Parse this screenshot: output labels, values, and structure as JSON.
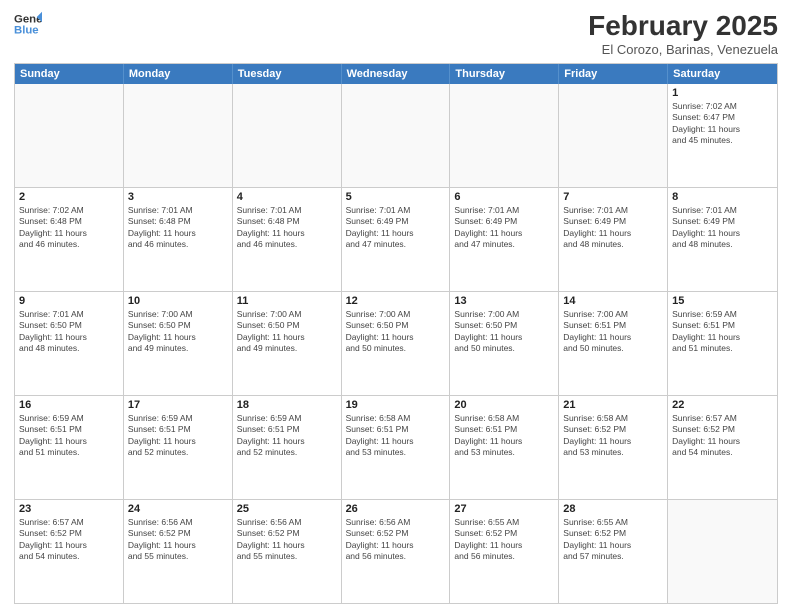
{
  "header": {
    "logo_general": "General",
    "logo_blue": "Blue",
    "month_year": "February 2025",
    "location": "El Corozo, Barinas, Venezuela"
  },
  "weekdays": [
    "Sunday",
    "Monday",
    "Tuesday",
    "Wednesday",
    "Thursday",
    "Friday",
    "Saturday"
  ],
  "rows": [
    [
      {
        "day": "",
        "info": ""
      },
      {
        "day": "",
        "info": ""
      },
      {
        "day": "",
        "info": ""
      },
      {
        "day": "",
        "info": ""
      },
      {
        "day": "",
        "info": ""
      },
      {
        "day": "",
        "info": ""
      },
      {
        "day": "1",
        "info": "Sunrise: 7:02 AM\nSunset: 6:47 PM\nDaylight: 11 hours\nand 45 minutes."
      }
    ],
    [
      {
        "day": "2",
        "info": "Sunrise: 7:02 AM\nSunset: 6:48 PM\nDaylight: 11 hours\nand 46 minutes."
      },
      {
        "day": "3",
        "info": "Sunrise: 7:01 AM\nSunset: 6:48 PM\nDaylight: 11 hours\nand 46 minutes."
      },
      {
        "day": "4",
        "info": "Sunrise: 7:01 AM\nSunset: 6:48 PM\nDaylight: 11 hours\nand 46 minutes."
      },
      {
        "day": "5",
        "info": "Sunrise: 7:01 AM\nSunset: 6:49 PM\nDaylight: 11 hours\nand 47 minutes."
      },
      {
        "day": "6",
        "info": "Sunrise: 7:01 AM\nSunset: 6:49 PM\nDaylight: 11 hours\nand 47 minutes."
      },
      {
        "day": "7",
        "info": "Sunrise: 7:01 AM\nSunset: 6:49 PM\nDaylight: 11 hours\nand 48 minutes."
      },
      {
        "day": "8",
        "info": "Sunrise: 7:01 AM\nSunset: 6:49 PM\nDaylight: 11 hours\nand 48 minutes."
      }
    ],
    [
      {
        "day": "9",
        "info": "Sunrise: 7:01 AM\nSunset: 6:50 PM\nDaylight: 11 hours\nand 48 minutes."
      },
      {
        "day": "10",
        "info": "Sunrise: 7:00 AM\nSunset: 6:50 PM\nDaylight: 11 hours\nand 49 minutes."
      },
      {
        "day": "11",
        "info": "Sunrise: 7:00 AM\nSunset: 6:50 PM\nDaylight: 11 hours\nand 49 minutes."
      },
      {
        "day": "12",
        "info": "Sunrise: 7:00 AM\nSunset: 6:50 PM\nDaylight: 11 hours\nand 50 minutes."
      },
      {
        "day": "13",
        "info": "Sunrise: 7:00 AM\nSunset: 6:50 PM\nDaylight: 11 hours\nand 50 minutes."
      },
      {
        "day": "14",
        "info": "Sunrise: 7:00 AM\nSunset: 6:51 PM\nDaylight: 11 hours\nand 50 minutes."
      },
      {
        "day": "15",
        "info": "Sunrise: 6:59 AM\nSunset: 6:51 PM\nDaylight: 11 hours\nand 51 minutes."
      }
    ],
    [
      {
        "day": "16",
        "info": "Sunrise: 6:59 AM\nSunset: 6:51 PM\nDaylight: 11 hours\nand 51 minutes."
      },
      {
        "day": "17",
        "info": "Sunrise: 6:59 AM\nSunset: 6:51 PM\nDaylight: 11 hours\nand 52 minutes."
      },
      {
        "day": "18",
        "info": "Sunrise: 6:59 AM\nSunset: 6:51 PM\nDaylight: 11 hours\nand 52 minutes."
      },
      {
        "day": "19",
        "info": "Sunrise: 6:58 AM\nSunset: 6:51 PM\nDaylight: 11 hours\nand 53 minutes."
      },
      {
        "day": "20",
        "info": "Sunrise: 6:58 AM\nSunset: 6:51 PM\nDaylight: 11 hours\nand 53 minutes."
      },
      {
        "day": "21",
        "info": "Sunrise: 6:58 AM\nSunset: 6:52 PM\nDaylight: 11 hours\nand 53 minutes."
      },
      {
        "day": "22",
        "info": "Sunrise: 6:57 AM\nSunset: 6:52 PM\nDaylight: 11 hours\nand 54 minutes."
      }
    ],
    [
      {
        "day": "23",
        "info": "Sunrise: 6:57 AM\nSunset: 6:52 PM\nDaylight: 11 hours\nand 54 minutes."
      },
      {
        "day": "24",
        "info": "Sunrise: 6:56 AM\nSunset: 6:52 PM\nDaylight: 11 hours\nand 55 minutes."
      },
      {
        "day": "25",
        "info": "Sunrise: 6:56 AM\nSunset: 6:52 PM\nDaylight: 11 hours\nand 55 minutes."
      },
      {
        "day": "26",
        "info": "Sunrise: 6:56 AM\nSunset: 6:52 PM\nDaylight: 11 hours\nand 56 minutes."
      },
      {
        "day": "27",
        "info": "Sunrise: 6:55 AM\nSunset: 6:52 PM\nDaylight: 11 hours\nand 56 minutes."
      },
      {
        "day": "28",
        "info": "Sunrise: 6:55 AM\nSunset: 6:52 PM\nDaylight: 11 hours\nand 57 minutes."
      },
      {
        "day": "",
        "info": ""
      }
    ]
  ]
}
